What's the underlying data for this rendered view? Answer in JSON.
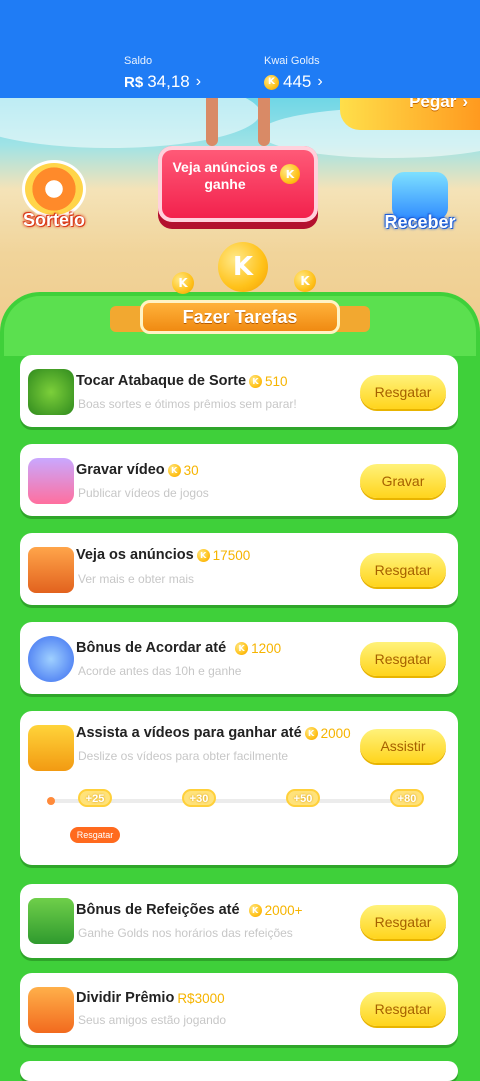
{
  "header": {
    "saldo_label": "Saldo",
    "saldo_currency": "R$",
    "saldo_value": "34,18",
    "golds_label": "Kwai Golds",
    "golds_value": "445"
  },
  "hero": {
    "pegar_label": "Pegar",
    "watch_button_label": "Veja anúncios e ganhe",
    "sorteio_label": "Sorteio",
    "receber_label": "Receber",
    "coin_glyph": "K"
  },
  "tasks_title": "Fazer Tarefas",
  "tasks": [
    {
      "title": "Tocar Atabaque de Sorte",
      "reward": "510",
      "desc": "Boas sortes e ótimos prêmios sem parar!",
      "button": "Resgatar",
      "icon": "drum-icon"
    },
    {
      "title": "Gravar vídeo",
      "reward": "30",
      "desc": "Publicar vídeos de jogos",
      "button": "Gravar",
      "icon": "record-video-icon"
    },
    {
      "title": "Veja os anúncios",
      "reward": "17500",
      "desc": "Ver mais e obter mais",
      "button": "Resgatar",
      "icon": "tv-icon"
    },
    {
      "title": "Bônus de Acordar até",
      "reward": "1200",
      "desc": "Acorde antes das 10h e ganhe",
      "button": "Resgatar",
      "icon": "alarm-icon"
    },
    {
      "title": "Assista a vídeos para ganhar até",
      "reward": "2000",
      "desc": "Deslize os vídeos para obter facilmente",
      "button": "Assistir",
      "icon": "camera-icon",
      "milestones": [
        "+25",
        "+30",
        "+50",
        "+80"
      ],
      "milestone_button": "Resgatar"
    },
    {
      "title": "Bônus de Refeições até",
      "reward": "2000+",
      "desc": "Ganhe Golds nos horários das refeições",
      "button": "Resgatar",
      "icon": "meal-calendar-icon"
    },
    {
      "title": "Dividir Prêmio",
      "reward": "R$3000",
      "desc": "Seus amigos estão jogando",
      "button": "Resgatar",
      "icon": "gift-icon"
    }
  ],
  "colors": {
    "header_blue": "#1f7cf5",
    "panel_green": "#3fd03a",
    "button_yellow": "#ffd41c",
    "reward_gold": "#f6b400"
  }
}
